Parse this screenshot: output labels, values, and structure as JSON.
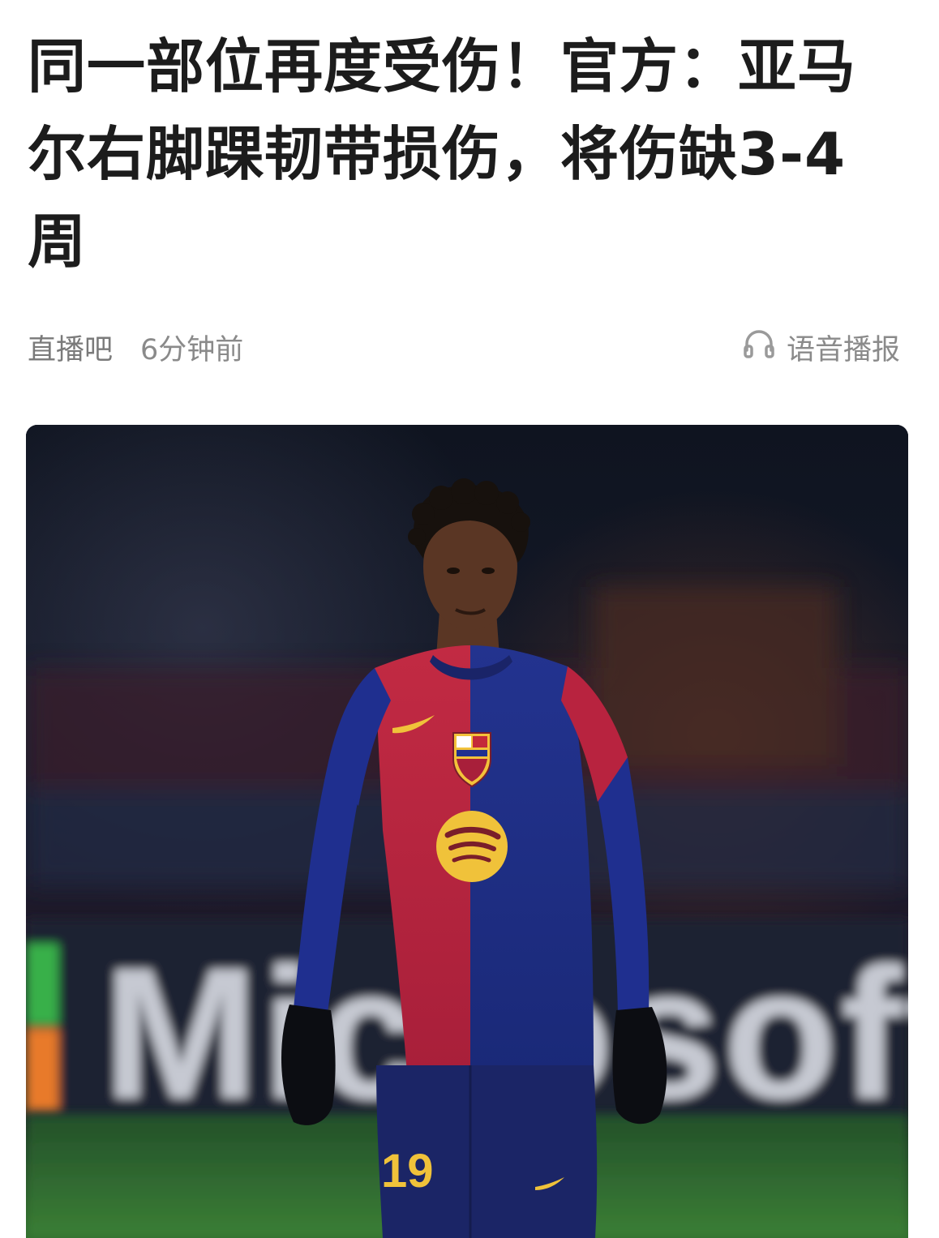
{
  "article": {
    "headline": "同一部位再度受伤！官方：亚马尔右脚踝韧带损伤，将伤缺3-4周",
    "source": "直播吧",
    "time_ago": "6分钟前",
    "audio_label": "语音播报",
    "audio_icon": "headphones-icon"
  },
  "hero_image": {
    "description_icon": "photo",
    "board_text": "Microsoft",
    "shirt_number": "19",
    "colors": {
      "kit_red": "#b8233f",
      "kit_blue": "#1d2e86",
      "sponsor_gold": "#f0c23a",
      "pitch_green": "#2f6b2c"
    }
  }
}
